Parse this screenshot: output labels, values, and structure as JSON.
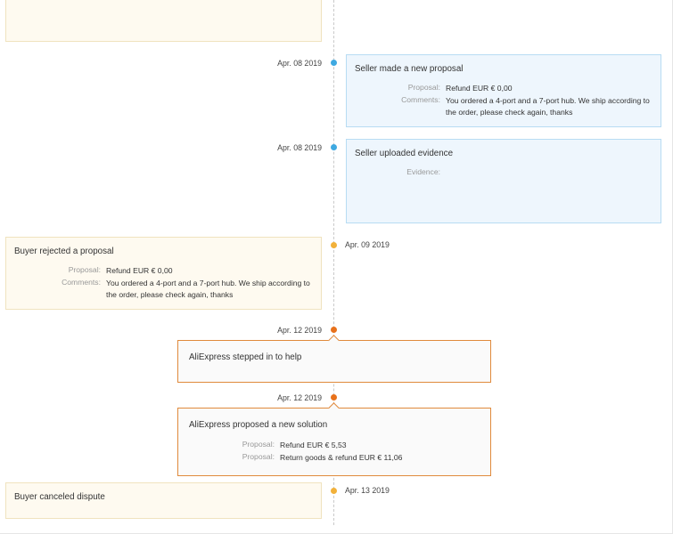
{
  "events": [
    {
      "date": "Apr. 08 2019",
      "title": "Seller made a new proposal",
      "proposal_label": "Proposal:",
      "proposal_value": "Refund EUR € 0,00",
      "comments_label": "Comments:",
      "comments_value": "You ordered a 4-port and a 7-port hub. We ship according to the order, please check again, thanks"
    },
    {
      "date": "Apr. 08 2019",
      "title": "Seller uploaded evidence",
      "evidence_label": "Evidence:"
    },
    {
      "date": "Apr. 09 2019",
      "title": "Buyer rejected a proposal",
      "proposal_label": "Proposal:",
      "proposal_value": "Refund EUR € 0,00",
      "comments_label": "Comments:",
      "comments_value": "You ordered a 4-port and a 7-port hub. We ship according to the order, please check again, thanks"
    },
    {
      "date": "Apr. 12 2019",
      "title": "AliExpress stepped in to help"
    },
    {
      "date": "Apr. 12 2019",
      "title": "AliExpress proposed a new solution",
      "proposal_label": "Proposal:",
      "proposal_value": "Refund EUR € 5,53",
      "proposal2_label": "Proposal:",
      "proposal2_value": "Return goods & refund EUR € 11,06"
    },
    {
      "date": "Apr. 13 2019",
      "title": "Buyer canceled dispute"
    }
  ],
  "colors": {
    "seller_dot": "#3fa9e1",
    "buyer_dot": "#f2b13a",
    "aliexpress_dot": "#e8711b"
  }
}
